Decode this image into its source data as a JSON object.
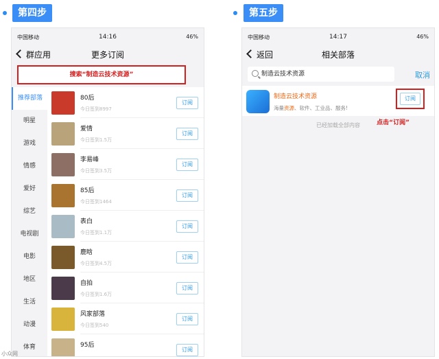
{
  "left": {
    "step_label": "第四步",
    "status": {
      "carrier": "中国移动",
      "time": "14:16",
      "battery": "46%"
    },
    "nav": {
      "back": "群应用",
      "title": "更多订阅"
    },
    "search_hint": "搜索“制造云技术资源”",
    "sidebar": [
      "推荐部落",
      "明星",
      "游戏",
      "情感",
      "爱好",
      "综艺",
      "电视剧",
      "电影",
      "地区",
      "生活",
      "动漫",
      "体育"
    ],
    "rows": [
      {
        "name": "80后",
        "sub": "今日签到8997",
        "btn": "订阅",
        "color": "#c93a2b"
      },
      {
        "name": "爱情",
        "sub": "今日签到1.5万",
        "btn": "订阅",
        "color": "#b8a37a"
      },
      {
        "name": "李易峰",
        "sub": "今日签到3.5万",
        "btn": "订阅",
        "color": "#8d6f66"
      },
      {
        "name": "85后",
        "sub": "今日签到1464",
        "btn": "订阅",
        "color": "#a8742f"
      },
      {
        "name": "表白",
        "sub": "今日签到1.1万",
        "btn": "订阅",
        "color": "#a9bcc6"
      },
      {
        "name": "鹿晗",
        "sub": "今日签到4.5万",
        "btn": "订阅",
        "color": "#7a5a2a"
      },
      {
        "name": "自拍",
        "sub": "今日签到1.6万",
        "btn": "订阅",
        "color": "#4a3a4a"
      },
      {
        "name": "风家部落",
        "sub": "今日签到540",
        "btn": "订阅",
        "color": "#d9b43d"
      },
      {
        "name": "95后",
        "sub": "",
        "btn": "订阅",
        "color": "#c8b28a"
      }
    ]
  },
  "right": {
    "step_label": "第五步",
    "status": {
      "carrier": "中国移动",
      "time": "14:17",
      "battery": "46%"
    },
    "nav": {
      "back": "返回",
      "title": "相关部落"
    },
    "search_value": "制造云技术资源",
    "cancel": "取消",
    "result": {
      "name": "制造云技术资源",
      "desc_pre": "海量",
      "desc_hl": "资源",
      "desc_post": "、软件、工业品、服务!",
      "btn": "订阅"
    },
    "click_note": "点击“订阅”",
    "loaded_text": "已经加载全部内容"
  },
  "watermark": "小众网"
}
